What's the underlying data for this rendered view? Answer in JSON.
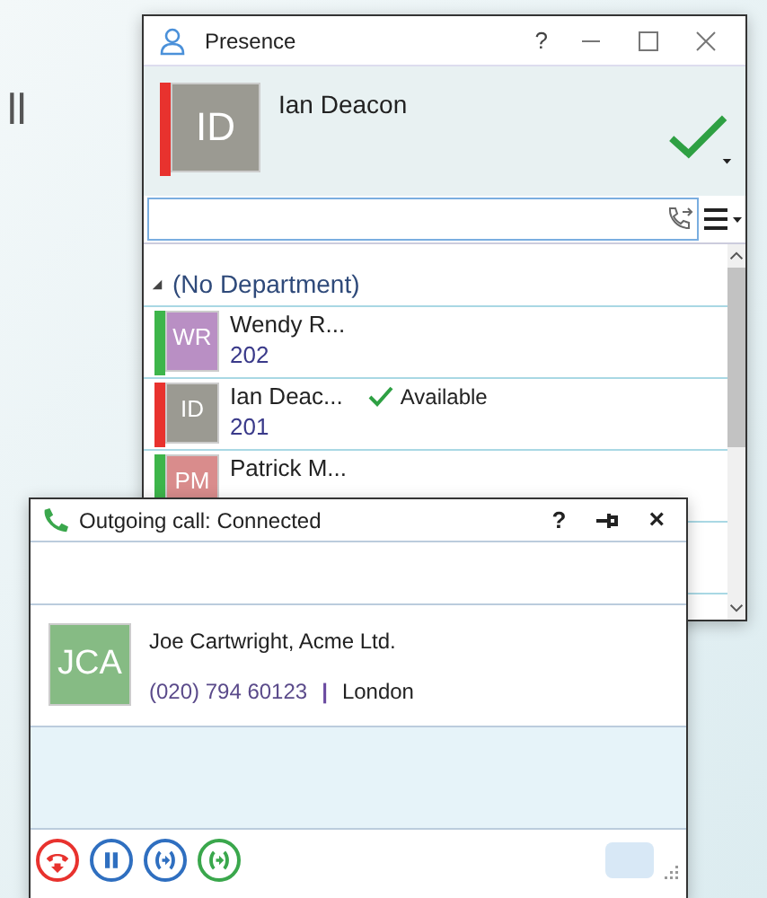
{
  "backdrop_text": "ll",
  "presence": {
    "title": "Presence",
    "help": "?",
    "self": {
      "avatar": {
        "initials": "ID",
        "color": "#9b9a92"
      },
      "name": "Ian Deacon",
      "color": "#e8322e"
    },
    "group": {
      "label": "(No Department)",
      "expanded": true
    },
    "contacts": [
      {
        "avatar": {
          "initials": "WR",
          "color": "#b98fc4"
        },
        "name": "Wendy R...",
        "ext": "202",
        "color": "#3db54a"
      },
      {
        "avatar": {
          "initials": "ID",
          "color": "#9b9a92"
        },
        "name": "Ian Deac...",
        "ext": "201",
        "color": "#e8322e",
        "status": "Available"
      },
      {
        "avatar": {
          "initials": "PM",
          "color": "#d98c8c"
        },
        "name": "Patrick M...",
        "color": "#3db54a"
      }
    ]
  },
  "call": {
    "title": "Outgoing call: Connected",
    "help": "?",
    "close": "×",
    "contact": {
      "avatar": {
        "initials": "JCA",
        "color": "#86bb84"
      },
      "name": "Joe Cartwright, Acme Ltd.",
      "phone": "(020) 794 60123",
      "separator": "|",
      "location": "London"
    },
    "actions": [
      {
        "kind": "hangup",
        "color": "#e8322e"
      },
      {
        "kind": "hold",
        "color": "#2f6fc0"
      },
      {
        "kind": "transfer",
        "color": "#2f6fc0"
      },
      {
        "kind": "consult",
        "color": "#3aa74c"
      }
    ]
  }
}
